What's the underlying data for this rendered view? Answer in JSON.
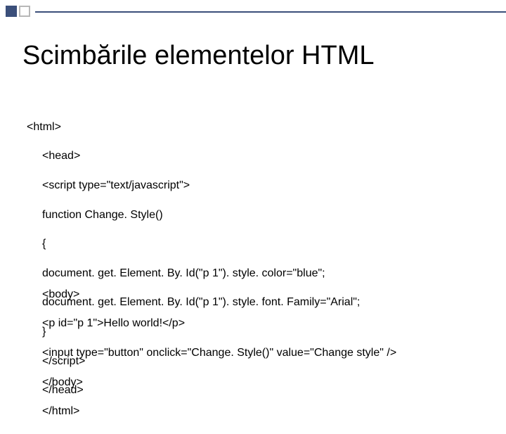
{
  "decoration": {
    "accent_color": "#3b4f7a",
    "outline_color": "#b8b8b8"
  },
  "title": "Scimbările elementelor HTML",
  "code": {
    "block1": {
      "line1": "<html>",
      "line2": "<head>",
      "line3": "<script type=\"text/javascript\">",
      "line4": "function Change. Style()",
      "line5": "{",
      "line6": "document. get. Element. By. Id(\"p 1\"). style. color=\"blue\";",
      "line7": "document. get. Element. By. Id(\"p 1\"). style. font. Family=\"Arial\";",
      "line8": "}",
      "line9": "</script>",
      "line10": "</head>"
    },
    "block2": {
      "line1": "<body>",
      "line2": "<p id=\"p 1\">Hello world!</p>",
      "line3": "<input type=\"button\" onclick=\"Change. Style()\" value=\"Change style\" />",
      "line4": "</body>",
      "line5": "</html>"
    }
  }
}
